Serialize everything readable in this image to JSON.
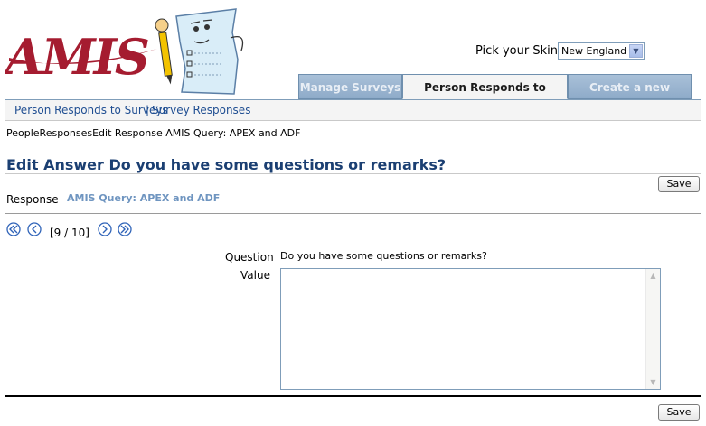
{
  "app": {
    "logo_text": "AMIS"
  },
  "skin": {
    "label": "Pick your Skin",
    "selected": "New England"
  },
  "tabs": [
    {
      "label": "Manage Surveys",
      "active": false
    },
    {
      "label": "Person Responds to Surveys",
      "active": true
    },
    {
      "label": "Create a new Person",
      "active": false
    }
  ],
  "subnav": {
    "items": [
      {
        "label": "Person Responds to Surveys"
      },
      {
        "label": "Survey Responses"
      }
    ],
    "separator": "|"
  },
  "breadcrumb": "PeopleResponsesEdit Response AMIS Query: APEX and ADF",
  "page": {
    "title": "Edit Answer Do you have some questions or remarks?"
  },
  "toolbar": {
    "save_label": "Save"
  },
  "response": {
    "label": "Response",
    "value": "AMIS Query: APEX and ADF"
  },
  "pager": {
    "text": "[9 / 10]"
  },
  "form": {
    "question_label": "Question",
    "question_text": "Do you have some questions or remarks?",
    "value_label": "Value",
    "value_text": ""
  },
  "colors": {
    "brand": "#a51c30",
    "accent": "#1b3f72",
    "tab_inactive": "#8eabc9",
    "link": "#1f4e92",
    "icon_blue": "#2f63b8"
  }
}
